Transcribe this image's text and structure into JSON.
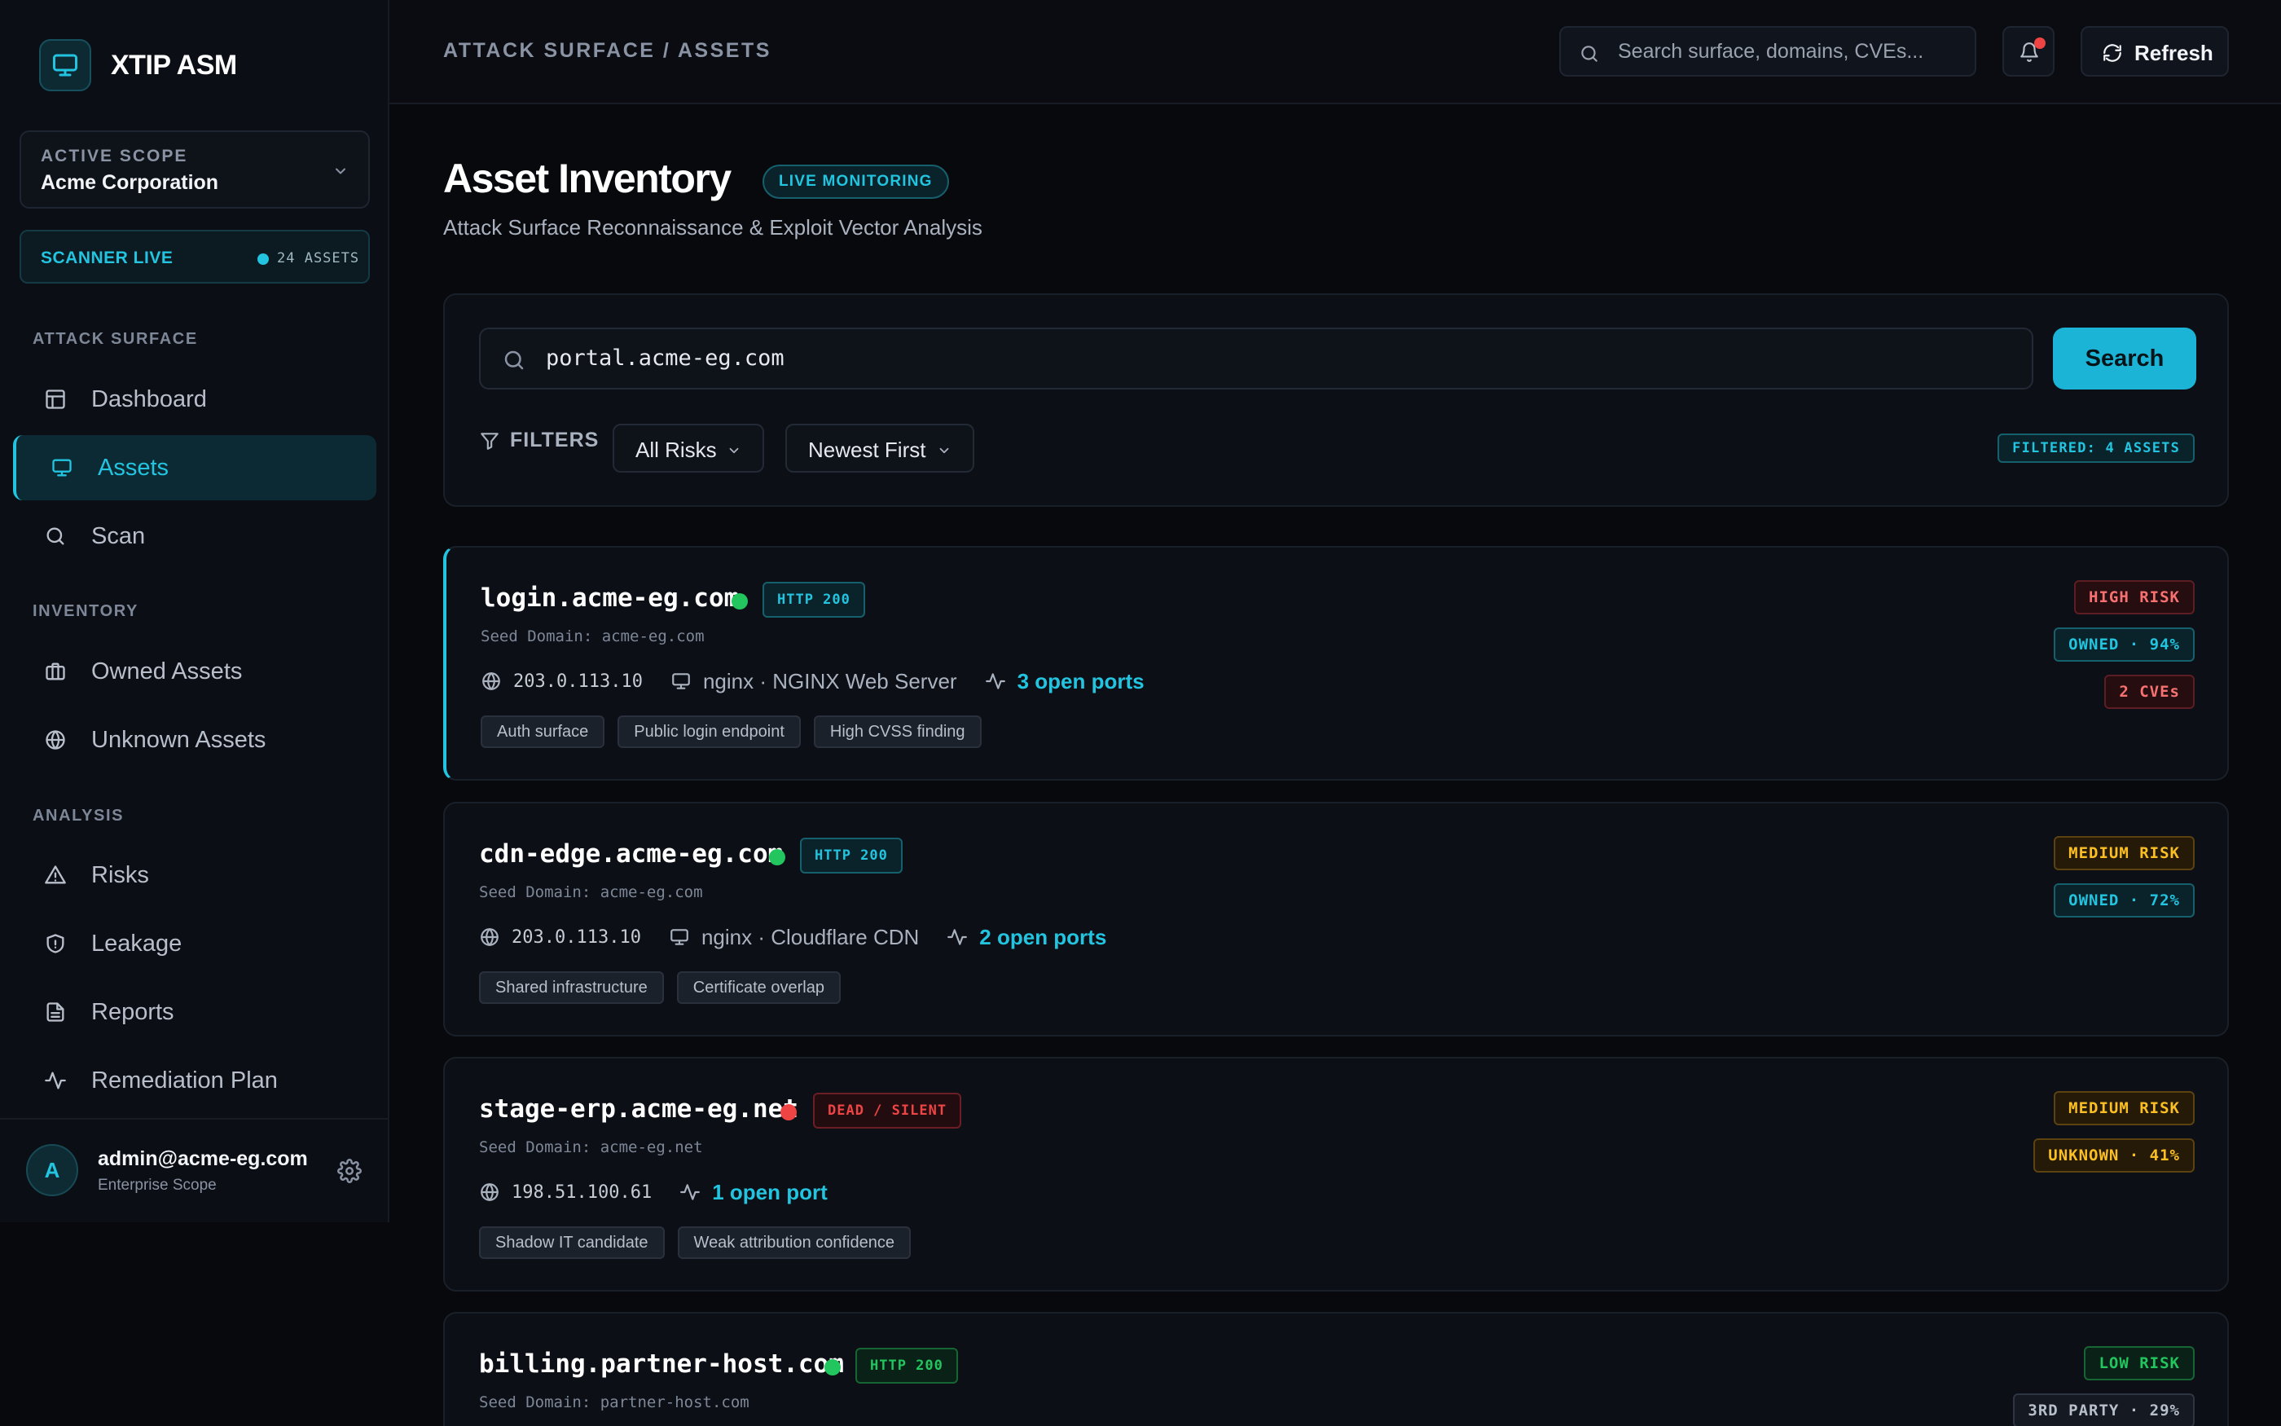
{
  "app": {
    "name": "XTIP ASM"
  },
  "scope": {
    "caption": "ACTIVE SCOPE",
    "value": "Acme Corporation"
  },
  "scanner": {
    "label": "SCANNER LIVE",
    "count": "24 ASSETS"
  },
  "sidebar": {
    "sections": [
      {
        "title": "ATTACK SURFACE"
      },
      {
        "title": "INVENTORY"
      },
      {
        "title": "ANALYSIS"
      }
    ],
    "items": [
      {
        "label": "Dashboard",
        "icon": "layout-icon"
      },
      {
        "label": "Assets",
        "icon": "monitor-icon",
        "active": true
      },
      {
        "label": "Scan",
        "icon": "search-icon"
      },
      {
        "label": "Owned Assets",
        "icon": "briefcase-icon"
      },
      {
        "label": "Unknown Assets",
        "icon": "globe-icon"
      },
      {
        "label": "Risks",
        "icon": "warning-icon"
      },
      {
        "label": "Leakage",
        "icon": "shield-icon"
      },
      {
        "label": "Reports",
        "icon": "document-icon"
      },
      {
        "label": "Remediation Plan",
        "icon": "activity-icon"
      }
    ]
  },
  "user": {
    "initial": "A",
    "email": "admin@acme-eg.com",
    "scope": "Enterprise Scope"
  },
  "topbar": {
    "breadcrumb": "ATTACK SURFACE / ASSETS",
    "search_placeholder": "Search surface, domains, CVEs...",
    "refresh_label": "Refresh"
  },
  "page": {
    "title": "Asset Inventory",
    "badge": "LIVE MONITORING",
    "subtitle": "Attack Surface Reconnaissance & Exploit Vector Analysis"
  },
  "search": {
    "value": "portal.acme-eg.com",
    "button": "Search",
    "filters_label": "FILTERS",
    "risk_filter": "All Risks",
    "sort": "Newest First",
    "filtered_count": "FILTERED: 4 ASSETS"
  },
  "colors": {
    "accent": "#22c4e0",
    "high": "#f87171",
    "medium": "#fbbf24",
    "low": "#22c55e",
    "alive": "#22c55e",
    "dead": "#ef4444"
  },
  "assets": [
    {
      "host": "login.acme-eg.com",
      "status": "alive",
      "http": "HTTP 200",
      "seed": "Seed Domain: acme-eg.com",
      "ip": "203.0.113.10",
      "server": "nginx · NGINX Web Server",
      "ports": "3 open ports",
      "tags": [
        "Auth surface",
        "Public login endpoint",
        "High CVSS finding"
      ],
      "risk": "HIGH RISK",
      "ownership": "OWNED · 94%",
      "cves": "2 CVEs"
    },
    {
      "host": "cdn-edge.acme-eg.com",
      "status": "alive",
      "http": "HTTP 200",
      "seed": "Seed Domain: acme-eg.com",
      "ip": "203.0.113.10",
      "server": "nginx · Cloudflare CDN",
      "ports": "2 open ports",
      "tags": [
        "Shared infrastructure",
        "Certificate overlap"
      ],
      "risk": "MEDIUM RISK",
      "ownership": "OWNED · 72%"
    },
    {
      "host": "stage-erp.acme-eg.net",
      "status": "dead",
      "http": "DEAD / SILENT",
      "seed": "Seed Domain: acme-eg.net",
      "ip": "198.51.100.61",
      "ports": "1 open port",
      "tags": [
        "Shadow IT candidate",
        "Weak attribution confidence"
      ],
      "risk": "MEDIUM RISK",
      "ownership": "UNKNOWN · 41%"
    },
    {
      "host": "billing.partner-host.com",
      "status": "alive",
      "http": "HTTP 200",
      "seed": "Seed Domain: partner-host.com",
      "risk": "LOW RISK",
      "ownership": "3RD PARTY · 29%"
    }
  ]
}
